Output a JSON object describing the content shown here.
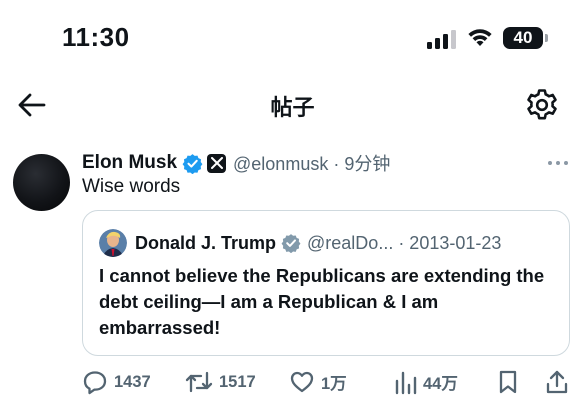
{
  "status_bar": {
    "time": "11:30",
    "battery_level": "40",
    "icons": [
      "signal-icon",
      "wifi-icon",
      "battery-icon"
    ]
  },
  "header": {
    "title": "帖子",
    "back_icon": "arrow-left-icon",
    "settings_icon": "gear-icon"
  },
  "post": {
    "author_name": "Elon Musk",
    "handle_time": "@elonmusk · 9分钟",
    "text": "Wise words",
    "badges": [
      "verified-badge-icon",
      "x-affiliate-badge-icon"
    ],
    "more_icon": "more-horizontal-icon",
    "quote": {
      "author_name": "Donald J. Trump",
      "handle_date": "@realDo... · 2013-01-23",
      "text": "I cannot believe the Republicans are extending the debt ceiling—I am a Republican & I am embarrassed!",
      "badges": [
        "verified-badge-gray-icon"
      ]
    },
    "actions": {
      "replies": "1437",
      "reposts": "1517",
      "likes": "1万",
      "views": "44万"
    }
  },
  "colors": {
    "text_primary": "#0f1419",
    "text_secondary": "#536471",
    "verified_blue": "#1d9bf0",
    "verified_gray": "#829aab",
    "border": "#cfd9de"
  }
}
